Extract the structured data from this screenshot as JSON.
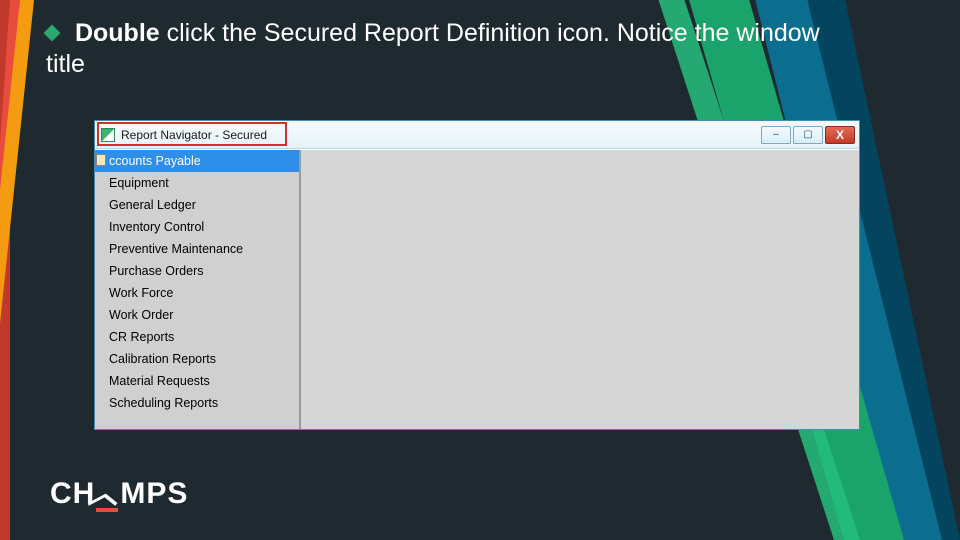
{
  "bullet": {
    "bold_lead": "Double",
    "rest": " click the Secured Report Definition icon. Notice the window title"
  },
  "window": {
    "title": "Report Navigator - Secured",
    "controls": {
      "minimize": "–",
      "maximize": "▢",
      "close": "X"
    },
    "tree": [
      "ccounts Payable",
      "Equipment",
      "General Ledger",
      "Inventory Control",
      "Preventive Maintenance",
      "Purchase Orders",
      "Work Force",
      "Work Order",
      "CR Reports",
      "Calibration Reports",
      "Material Requests",
      "Scheduling Reports"
    ],
    "selected_index": 0
  },
  "logo": {
    "part1": "CH",
    "slash": "/\\",
    "part2": "MPS"
  }
}
